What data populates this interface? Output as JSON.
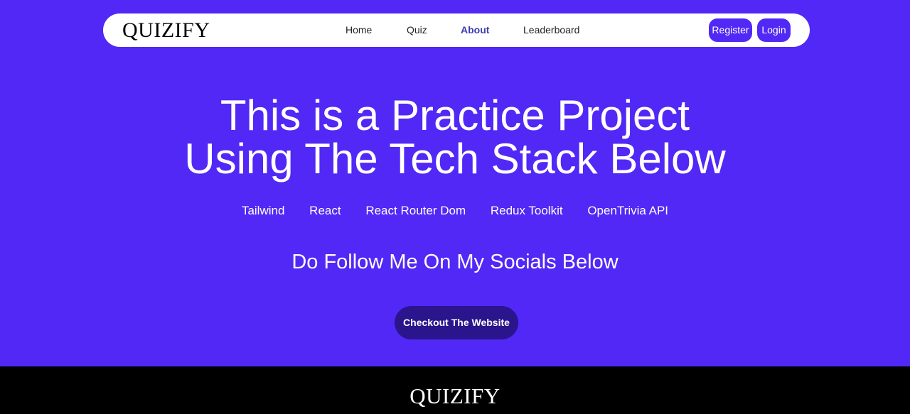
{
  "navbar": {
    "logo": "QUIZIFY",
    "links": [
      {
        "label": "Home",
        "active": false
      },
      {
        "label": "Quiz",
        "active": false
      },
      {
        "label": "About",
        "active": true
      },
      {
        "label": "Leaderboard",
        "active": false
      }
    ],
    "register_label": "Register",
    "login_label": "Login"
  },
  "hero": {
    "title_line1": "This is a Practice Project",
    "title_line2": "Using The Tech Stack Below",
    "stack": [
      "Tailwind",
      "React",
      "React Router Dom",
      "Redux Toolkit",
      "OpenTrivia API"
    ],
    "follow_text": "Do Follow Me On My Socials Below",
    "cta_label": "Checkout The Website"
  },
  "footer": {
    "logo": "QUIZIFY"
  },
  "colors": {
    "background": "#5128f5",
    "cta": "#2a158c",
    "active_link": "#3a3fb0",
    "footer": "#000000"
  }
}
